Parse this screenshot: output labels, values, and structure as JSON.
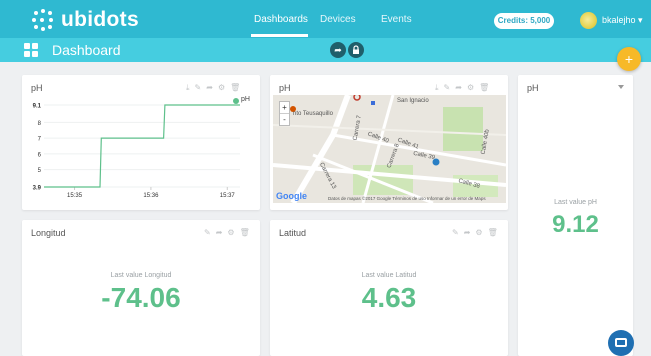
{
  "brand": {
    "name": "ubidots"
  },
  "nav": {
    "items": [
      "Dashboards",
      "Devices",
      "Events"
    ],
    "credits": "Credits: 5,000",
    "user": "bkalejho"
  },
  "subbar": {
    "title": "Dashboard"
  },
  "widgets": {
    "ph_chart": {
      "title": "pH",
      "legend": "pH"
    },
    "map": {
      "labels": [
        "San Ignacio",
        "nto Teusaquillo",
        "Carrera 7",
        "Calle 40",
        "Calle 39",
        "Carrera 8",
        "Calle 41",
        "Calle 38",
        "Carrera 13",
        "Calle 40b"
      ],
      "google": "Google",
      "footer": "Datos de mapas ©2017 Google   Términos de uso   Informar de un error de Maps"
    },
    "ph_value": {
      "title": "pH",
      "label": "Last value pH",
      "value": "9.12"
    },
    "longitud": {
      "title": "Longitud",
      "label": "Last value Longitud",
      "value": "-74.06"
    },
    "latitud": {
      "title": "Latitud",
      "label": "Last value Latitud",
      "value": "4.63"
    }
  },
  "chart_data": {
    "type": "line",
    "title": "pH",
    "series": [
      {
        "name": "pH",
        "color": "#5ec08b",
        "points": [
          [
            "15:34:36",
            3.9
          ],
          [
            "15:35:20",
            3.9
          ],
          [
            "15:35:21",
            7.0
          ],
          [
            "15:36:10",
            7.0
          ],
          [
            "15:36:11",
            9.1
          ],
          [
            "15:37:10",
            9.1
          ]
        ]
      }
    ],
    "x_ticks": [
      "15:35",
      "15:36",
      "15:37"
    ],
    "y_ticks": [
      "3.9",
      "5",
      "6",
      "7",
      "8",
      "9.1"
    ],
    "ylim": [
      3.9,
      9.1
    ],
    "grid": true,
    "legend": "top-right"
  }
}
